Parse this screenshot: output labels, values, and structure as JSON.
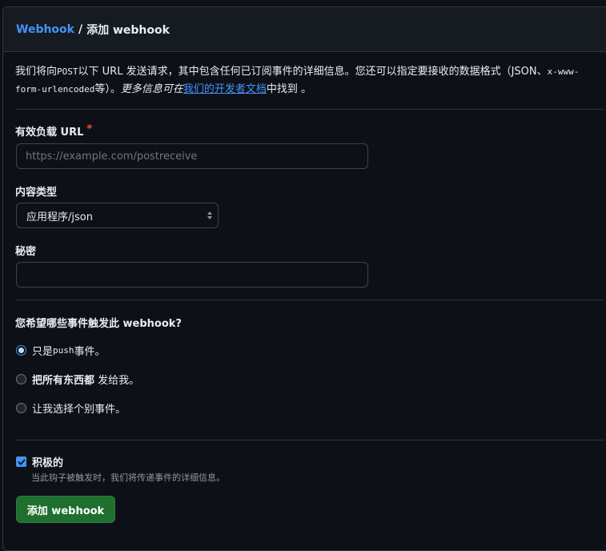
{
  "breadcrumb": {
    "parent": "Webhook",
    "separator": "/",
    "current": "添加 webhook"
  },
  "intro": {
    "part1": "我们将向",
    "post": "POST",
    "part2": "以下 URL 发送请求，其中包含任何已订阅事件的详细信息。您还可以指定要接收的数据格式（JSON、",
    "format_code": "x-www-form-urlencoded",
    "part3": "等）。",
    "more_info": "更多信息可在",
    "link": "我们的开发者文档",
    "part4": "中找到 。"
  },
  "payload_url": {
    "label": "有效负载 URL",
    "required_mark": "*",
    "value": "",
    "placeholder": "https://example.com/postreceive"
  },
  "content_type": {
    "label": "内容类型",
    "selected": "应用程序/json"
  },
  "secret": {
    "label": "秘密",
    "value": ""
  },
  "events": {
    "question": "您希望哪些事件触发此 webhook?",
    "option_push_prefix": "只是",
    "option_push_code": "push",
    "option_push_suffix": "事件。",
    "option_all_bold": "把所有东西都",
    "option_all_rest": "发给我。",
    "option_individual": "让我选择个别事件。",
    "selected": "push"
  },
  "active": {
    "label": "积极的",
    "checked": true,
    "note": "当此钩子被触发时，我们将传递事件的详细信息。"
  },
  "submit": {
    "label": "添加 webhook"
  },
  "colors": {
    "background": "#0d1117",
    "link": "#4493f8",
    "required": "#f85149",
    "submit": "#1f6f2f",
    "border": "#30363d"
  }
}
